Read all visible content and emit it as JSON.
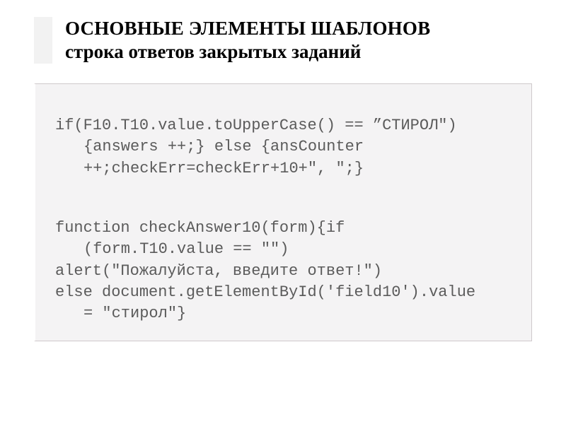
{
  "header": {
    "title_line1": "ОСНОВНЫЕ ЭЛЕМЕНТЫ ШАБЛОНОВ",
    "title_line2": "строка ответов закрытых заданий"
  },
  "code": {
    "block1": {
      "l1": "if(F10.T10.value.toUpperCase() == ”СТИРОЛ\")",
      "l2": "{answers ++;} else {ansCounter",
      "l3": "++;checkErr=checkErr+10+\", \";}"
    },
    "block2": {
      "l1": "function checkAnswer10(form){if",
      "l2": "(form.T10.value == \"\")",
      "l3": "alert(\"Пожалуйста, введите ответ!\")",
      "l4": "else document.getElementById('field10').value",
      "l5": "= \"стирол\"}"
    }
  }
}
